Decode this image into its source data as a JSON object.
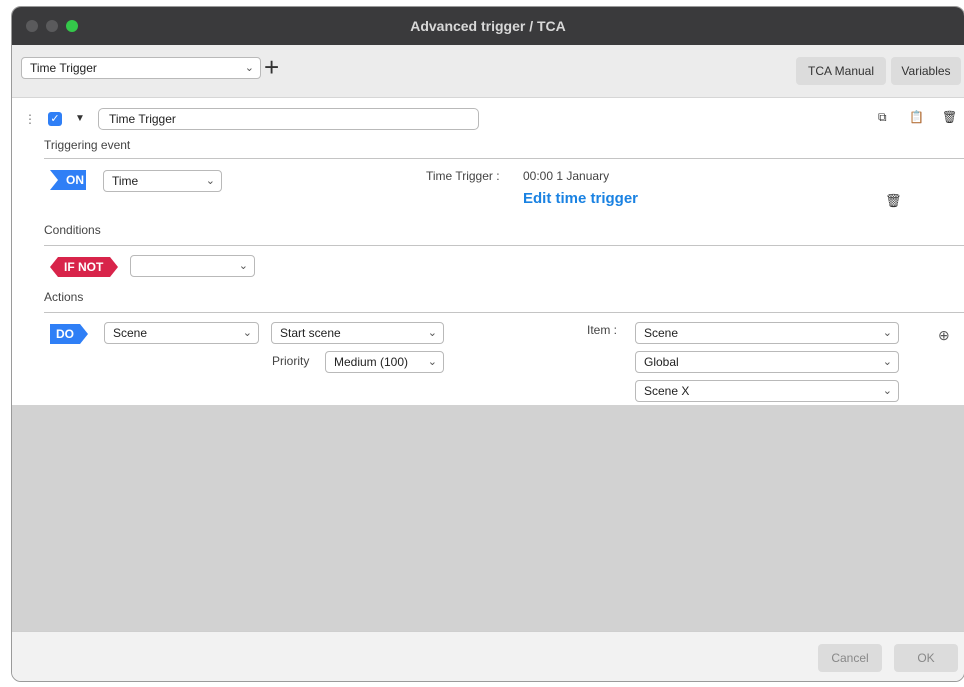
{
  "window": {
    "title": "Advanced trigger / TCA"
  },
  "toolbar": {
    "trigger_select": "Time Trigger",
    "tca_manual_label": "TCA Manual",
    "variables_label": "Variables"
  },
  "trigger": {
    "name": "Time Trigger",
    "enabled": true
  },
  "triggering_event": {
    "heading": "Triggering event",
    "badge": "ON",
    "event_type": "Time",
    "info_label": "Time Trigger :",
    "info_value": "00:00 1 January",
    "edit_link": "Edit time trigger"
  },
  "conditions": {
    "heading": "Conditions",
    "badge": "IF NOT",
    "select_value": ""
  },
  "actions": {
    "heading": "Actions",
    "badge": "DO",
    "type": "Scene",
    "action": "Start scene",
    "priority_label": "Priority",
    "priority_value": "Medium (100)",
    "item_label": "Item :",
    "item_values": [
      "Scene",
      "Global",
      "Scene X"
    ]
  },
  "footer": {
    "cancel_label": "Cancel",
    "ok_label": "OK"
  },
  "colors": {
    "accent": "#2f7ff6",
    "on_badge": "#2f7ff6",
    "if_not_badge": "#d8244a",
    "link": "#1a82e2"
  }
}
